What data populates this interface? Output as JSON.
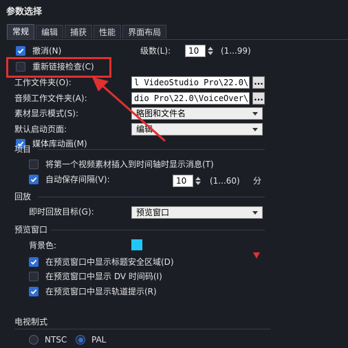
{
  "window": {
    "title": "参数选择"
  },
  "tabs": [
    {
      "label": "常规",
      "active": true
    },
    {
      "label": "编辑",
      "active": false
    },
    {
      "label": "捕获",
      "active": false
    },
    {
      "label": "性能",
      "active": false
    },
    {
      "label": "界面布局",
      "active": false
    }
  ],
  "undo": {
    "label": "撤消(N)",
    "checked": true
  },
  "levels": {
    "label": "级数(L):",
    "value": "10",
    "range": "(1...99)"
  },
  "relink": {
    "label": "重新链接检查(C)",
    "checked": false
  },
  "work_folder": {
    "label": "工作文件夹(O):",
    "value": "l VideoStudio Pro\\22.0\\",
    "browse": "..."
  },
  "audio_folder": {
    "label": "音频工作文件夹(A):",
    "value": "dio Pro\\22.0\\VoiceOver\\",
    "browse": "..."
  },
  "clip_display": {
    "label": "素材显示模式(S):",
    "value": "略图和文件名"
  },
  "default_page": {
    "label": "默认启动页面:",
    "value": "编辑"
  },
  "media_anim": {
    "label": "媒体库动画(M)",
    "checked": true
  },
  "project": {
    "heading": "项目",
    "first_clip": {
      "label": "将第一个视频素材插入到时间轴时显示消息(T)",
      "checked": false
    },
    "autosave": {
      "label": "自动保存间隔(V):",
      "checked": true,
      "value": "10",
      "range": "(1...60)",
      "unit": "分"
    }
  },
  "playback": {
    "heading": "回放",
    "target_label": "即时回放目标(G):",
    "target_value": "预览窗口"
  },
  "preview": {
    "heading": "预览窗口",
    "bg_label": "背景色:",
    "bg_color": "#22c8f5",
    "safe_area": {
      "label": "在预览窗口中显示标题安全区域(D)",
      "checked": true
    },
    "dv_timecode": {
      "label": "在预览窗口中显示 DV 时间码(I)",
      "checked": false
    },
    "track_hints": {
      "label": "在预览窗口中显示轨道提示(R)",
      "checked": true
    }
  },
  "tv": {
    "heading": "电视制式",
    "options": [
      {
        "label": "NTSC",
        "selected": false
      },
      {
        "label": "PAL",
        "selected": true
      }
    ]
  },
  "colors": {
    "accent": "#2e6fd6",
    "annotation": "#e03030"
  }
}
